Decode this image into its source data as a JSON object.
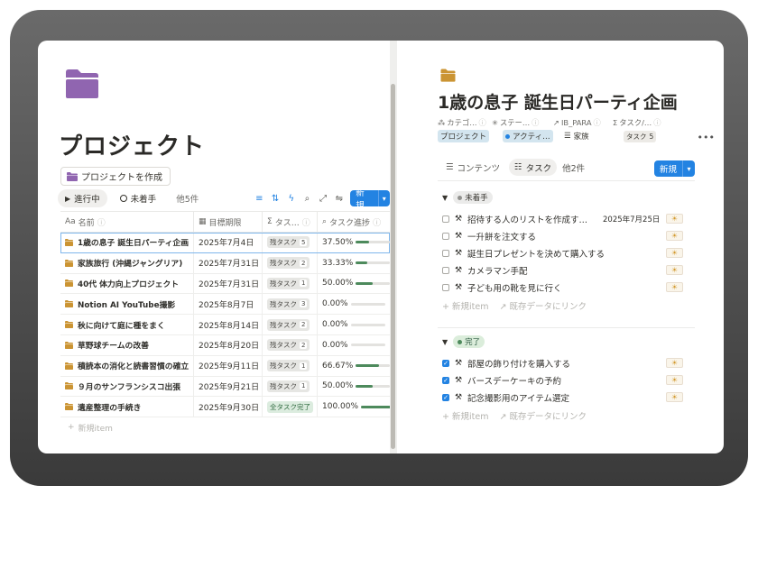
{
  "left": {
    "title": "プロジェクト",
    "create_button": "プロジェクトを作成",
    "views": [
      {
        "label": "進行中",
        "icon": "play-icon"
      },
      {
        "label": "未着手",
        "icon": "circle-icon"
      }
    ],
    "views_more": "他5件",
    "new_button": "新規",
    "columns": [
      "名前",
      "目標期限",
      "タス…",
      "タスク進捗"
    ],
    "rows": [
      {
        "name": "1歳の息子 誕生日パーティ企画",
        "date": "2025年7月4日",
        "tasks": "残タスク",
        "count": "5",
        "progress": "37.50%",
        "pct": 0.375
      },
      {
        "name": "家族旅行 (沖縄ジャングリア)",
        "date": "2025年7月31日",
        "tasks": "残タスク",
        "count": "2",
        "progress": "33.33%",
        "pct": 0.3333
      },
      {
        "name": "40代 体力向上プロジェクト",
        "date": "2025年7月31日",
        "tasks": "残タスク",
        "count": "1",
        "progress": "50.00%",
        "pct": 0.5
      },
      {
        "name": "Notion AI YouTube撮影",
        "date": "2025年8月7日",
        "tasks": "残タスク",
        "count": "3",
        "progress": "0.00%",
        "pct": 0
      },
      {
        "name": "秋に向けて庭に種をまく",
        "date": "2025年8月14日",
        "tasks": "残タスク",
        "count": "2",
        "progress": "0.00%",
        "pct": 0
      },
      {
        "name": "草野球チームの改善",
        "date": "2025年8月20日",
        "tasks": "残タスク",
        "count": "2",
        "progress": "0.00%",
        "pct": 0
      },
      {
        "name": "積読本の消化と読書習慣の確立",
        "date": "2025年9月11日",
        "tasks": "残タスク",
        "count": "1",
        "progress": "66.67%",
        "pct": 0.6667
      },
      {
        "name": "９月のサンフランシスコ出張",
        "date": "2025年9月21日",
        "tasks": "残タスク",
        "count": "1",
        "progress": "50.00%",
        "pct": 0.5
      },
      {
        "name": "遺産整理の手続き",
        "date": "2025年9月30日",
        "tasks": "全タスク完了",
        "count": "",
        "progress": "100.00%",
        "pct": 1.0
      }
    ],
    "add_item": "新規item"
  },
  "right": {
    "title": "1歳の息子 誕生日パーティ企画",
    "prop_labels": [
      "カテゴ…",
      "ステー…",
      "IB_PARA",
      "タスク/…"
    ],
    "prop_values": {
      "category": "プロジェクト",
      "status": "アクティ…",
      "para": "家族",
      "tasks": "タスク",
      "tasks_count": "5"
    },
    "more": "•••",
    "tabs": [
      "コンテンツ",
      "タスク"
    ],
    "tabs_more": "他2件",
    "new_button": "新規",
    "groups": [
      {
        "status": "未着手",
        "kind": "todo",
        "tasks": [
          {
            "label": "招待する人のリストを作成す…",
            "date": "2025年7月25日",
            "checked": false
          },
          {
            "label": "一升餅を注文する",
            "date": "",
            "checked": false
          },
          {
            "label": "誕生日プレゼントを決めて購入する",
            "date": "",
            "checked": false
          },
          {
            "label": "カメラマン手配",
            "date": "",
            "checked": false
          },
          {
            "label": "子ども用の靴を見に行く",
            "date": "",
            "checked": false
          }
        ]
      },
      {
        "status": "完了",
        "kind": "done",
        "tasks": [
          {
            "label": "部屋の飾り付けを購入する",
            "date": "",
            "checked": true
          },
          {
            "label": "バースデーケーキの予約",
            "date": "",
            "checked": true
          },
          {
            "label": "記念撮影用のアイテム選定",
            "date": "",
            "checked": true
          }
        ]
      }
    ],
    "add_item": "新規item",
    "link_existing": "既存データにリンク"
  },
  "colors": {
    "accent": "#2383e2",
    "folder_purple": "#9065b0",
    "folder_gold": "#cb9433",
    "progress_green": "#4d8a5c"
  }
}
